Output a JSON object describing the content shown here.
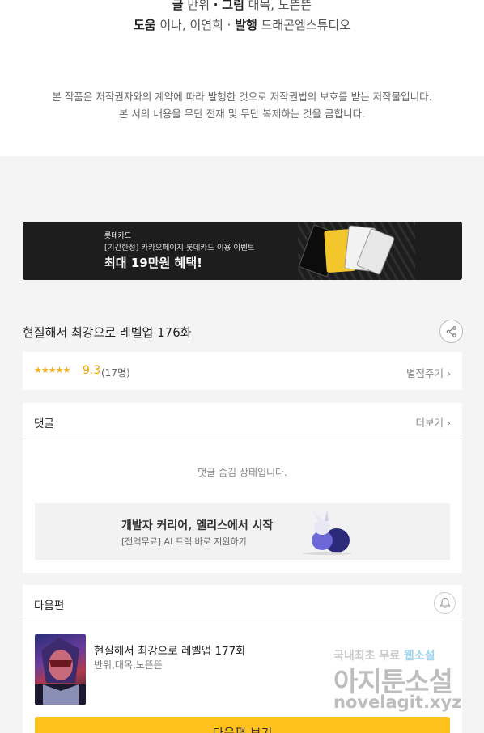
{
  "credits": {
    "writer_label": "글",
    "writer": "반위",
    "sep1": "·",
    "art_label": "그림",
    "art": "대목, 노뜬뜬",
    "help_label": "도움",
    "help": "이나, 이연희",
    "sep2": "·",
    "publisher_label": "발행",
    "publisher": "드래곤엠스튜디오"
  },
  "copyright": {
    "line1": "본 작품은 저작권자와의 계약에 따라 발행한 것으로 저작권법의 보호를 받는 저작물입니다.",
    "line2": "본 서의 내용을 무단 전재 및 무단 복제하는 것을 금합니다."
  },
  "banner": {
    "brand": "롯데카드",
    "subtitle": "[기간한정] 카카오페이지 롯데카드 이용 이벤트",
    "headline": "최대 19만원 혜택!"
  },
  "episode": {
    "title": "현질해서 최강으로 레벨업 176화"
  },
  "rating": {
    "stars": "★★★★★",
    "score": "9.3",
    "count": "(17명)",
    "action": "별점주기 ›"
  },
  "comments": {
    "label": "댓글",
    "more": "더보기 ›",
    "hidden_notice": "댓글 숨김 상태입니다."
  },
  "ad": {
    "title": "개발자 커리어, 엘리스에서 시작",
    "subtitle": "[전액무료] AI 트랙 바로 지원하기"
  },
  "next": {
    "label": "다음편",
    "title": "현질해서 최강으로 레벨업 177화",
    "authors": "반위,대목,노뜬뜬",
    "button": "다음편 보기"
  },
  "watermark": {
    "line1_a": "국내최초 무료 ",
    "line1_b": "웹소설",
    "line2": "아지툰소설",
    "line3": "novelagit.xyz"
  },
  "colors": {
    "accent_yellow": "#ffc21c",
    "star": "#f2b21b",
    "banner_bg": "#1d1d1d"
  }
}
